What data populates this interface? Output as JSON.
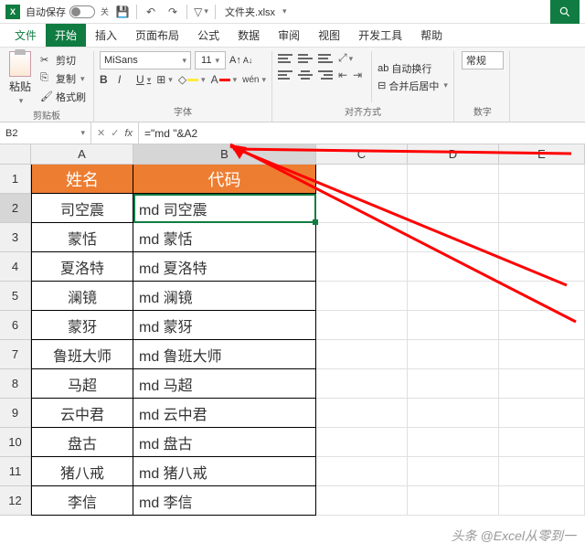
{
  "titlebar": {
    "autosave_label": "自动保存",
    "autosave_state": "关",
    "filename": "文件夹.xlsx"
  },
  "tabs": {
    "file": "文件",
    "home": "开始",
    "insert": "插入",
    "layout": "页面布局",
    "formulas": "公式",
    "data": "数据",
    "review": "审阅",
    "view": "视图",
    "dev": "开发工具",
    "help": "帮助"
  },
  "ribbon": {
    "clipboard": {
      "paste": "粘贴",
      "cut": "剪切",
      "copy": "复制",
      "format_painter": "格式刷",
      "group_label": "剪贴板"
    },
    "font": {
      "name": "MiSans",
      "size": "11",
      "group_label": "字体"
    },
    "align": {
      "wrap": "自动换行",
      "merge": "合并后居中",
      "group_label": "对齐方式"
    },
    "number": {
      "style": "常规",
      "group_label": "数字"
    }
  },
  "formula_bar": {
    "cell_ref": "B2",
    "formula": "=\"md \"&A2"
  },
  "columns": [
    "A",
    "B",
    "C",
    "D",
    "E"
  ],
  "table": {
    "header": {
      "a": "姓名",
      "b": "代码"
    },
    "rows": [
      {
        "n": "2",
        "a": "司空震",
        "b": "md 司空震"
      },
      {
        "n": "3",
        "a": "蒙恬",
        "b": "md 蒙恬"
      },
      {
        "n": "4",
        "a": "夏洛特",
        "b": "md 夏洛特"
      },
      {
        "n": "5",
        "a": "澜镜",
        "b": "md 澜镜"
      },
      {
        "n": "6",
        "a": "蒙犽",
        "b": "md 蒙犽"
      },
      {
        "n": "7",
        "a": "鲁班大师",
        "b": "md 鲁班大师"
      },
      {
        "n": "8",
        "a": "马超",
        "b": "md 马超"
      },
      {
        "n": "9",
        "a": "云中君",
        "b": "md 云中君"
      },
      {
        "n": "10",
        "a": "盘古",
        "b": "md 盘古"
      },
      {
        "n": "11",
        "a": "猪八戒",
        "b": "md 猪八戒"
      },
      {
        "n": "12",
        "a": "李信",
        "b": "md 李信"
      }
    ]
  },
  "watermark": "头条 @Excel从零到一"
}
